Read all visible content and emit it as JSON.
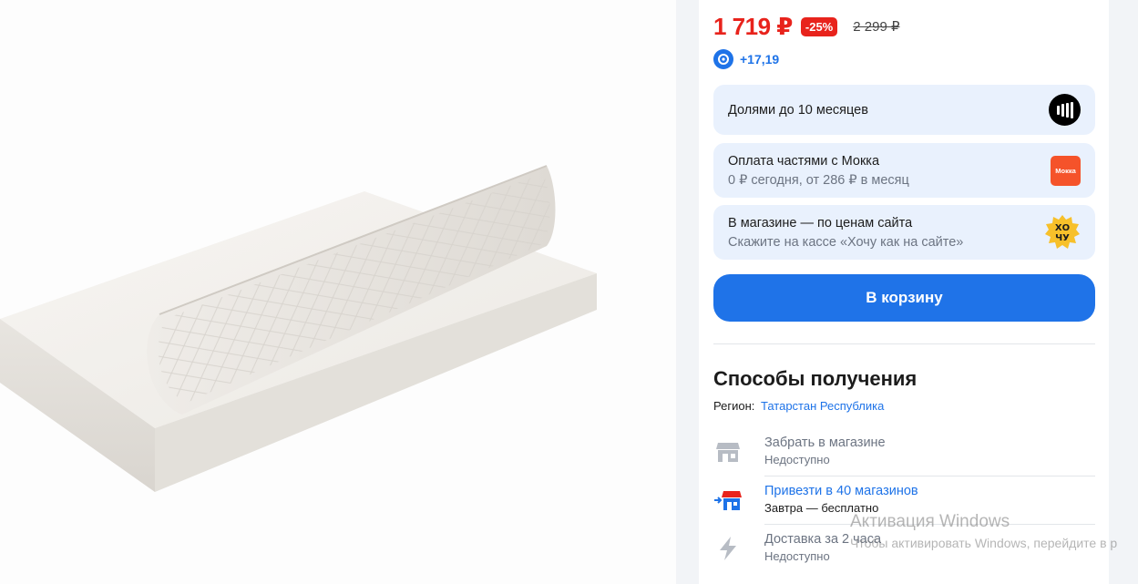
{
  "product": {
    "image_alt": "mattress-topper-product-image"
  },
  "price": {
    "current": "1 719 ₽",
    "discount": "-25%",
    "old": "2 299 ₽"
  },
  "bonus": {
    "value": "+17,19"
  },
  "payment_cards": [
    {
      "title": "Долями до 10 месяцев",
      "subtitle": "",
      "icon": "dolyami-icon"
    },
    {
      "title": "Оплата частями с Мокка",
      "subtitle": "0 ₽ сегодня, от 286 ₽ в месяц",
      "icon": "mokka-icon",
      "icon_text": "Мокка"
    },
    {
      "title": "В магазине — по ценам сайта",
      "subtitle": "Скажите на кассе «Хочу как на сайте»",
      "icon": "hochu-icon"
    }
  ],
  "cart_button": {
    "label": "В корзину"
  },
  "delivery": {
    "title": "Способы получения",
    "region_label": "Регион:",
    "region_value": "Татарстан Республика",
    "options": [
      {
        "title": "Забрать в магазине",
        "status": "Недоступно",
        "icon": "store-icon"
      },
      {
        "title": "Привезти в 40 магазинов",
        "status": "Завтра — бесплатно",
        "icon": "store-transfer-icon"
      },
      {
        "title": "Доставка за 2 часа",
        "status": "Недоступно",
        "icon": "lightning-icon"
      }
    ]
  },
  "watermark": {
    "line1": "Активация Windows",
    "line2": "Чтобы активировать Windows, перейдите в р"
  },
  "colors": {
    "accent": "#1f73e8",
    "price_red": "#e8231c",
    "card_bg": "#e9f1fd"
  }
}
